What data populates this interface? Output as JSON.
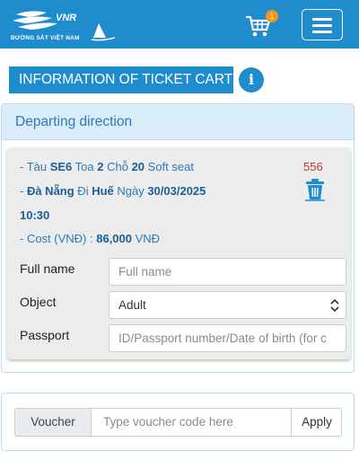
{
  "header": {
    "logo_initials": "VNR",
    "logo_text": "ĐƯỜNG SẮT VIỆT NAM",
    "cart_count": "1"
  },
  "page_title": "INFORMATION OF TICKET CART",
  "section": {
    "title": "Departing direction"
  },
  "ticket": {
    "train_prefix": "- Tàu ",
    "train": "SE6",
    "car_label": " Toa ",
    "car": "2",
    "seat_label": " Chỗ ",
    "seat": "20",
    "seat_type": " Soft seat",
    "route_prefix": "- ",
    "from": "Đà Nẵng",
    "route_mid": " Đi ",
    "to": "Huế",
    "date_label": " Ngày ",
    "date": "30/03/2025",
    "time": "10:30",
    "cost_label": "- Cost (VNĐ) : ",
    "cost": "86,000",
    "cost_unit": " VNĐ",
    "code": "556"
  },
  "form": {
    "full_name_label": "Full name",
    "full_name_placeholder": "Full name",
    "object_label": "Object",
    "object_value": "Adult",
    "passport_label": "Passport",
    "passport_placeholder": "ID/Passport number/Date of birth (for c"
  },
  "voucher": {
    "label": "Voucher",
    "placeholder": "Type voucher code here",
    "apply": "Apply"
  },
  "colors": {
    "brand_blue": "#1f8cce",
    "badge_orange": "#f7941d",
    "code_red": "#c23a2e"
  },
  "icons": [
    "vnr-logo-icon",
    "cart-icon",
    "hamburger-menu-icon",
    "info-icon",
    "trash-icon",
    "select-caret-icon"
  ]
}
